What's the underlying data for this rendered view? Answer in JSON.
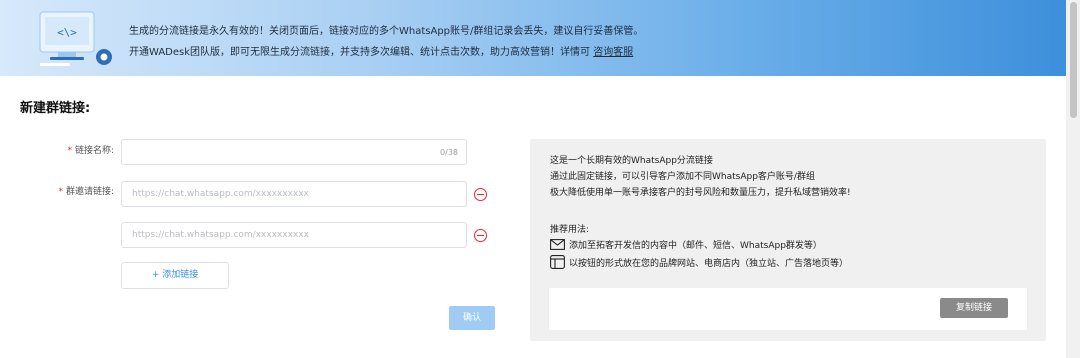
{
  "banner": {
    "line1": "生成的分流链接是永久有效的！关闭页面后，链接对应的多个WhatsApp账号/群组记录会丢失，建议自行妥善保管。",
    "line2_prefix": "开通WADesk团队版，即可无限生成分流链接，并支持多次编辑、统计点击次数，助力高效营销！详情可",
    "line2_link": "咨询客服",
    "illustration_text": "<\\>",
    "icon": "monitor-code-icon"
  },
  "form": {
    "section_title": "新建群链接:",
    "name_label": "链接名称:",
    "name_value": "",
    "name_counter": "0/38",
    "invite_label": "群邀请链接:",
    "invite_links": [
      {
        "value": "",
        "placeholder": "https://chat.whatsapp.com/xxxxxxxxxx"
      },
      {
        "value": "",
        "placeholder": "https://chat.whatsapp.com/xxxxxxxxxx"
      }
    ],
    "add_link_label": "+ 添加链接",
    "confirm_label": "确认"
  },
  "info_panel": {
    "lines": [
      "这是一个长期有效的WhatsApp分流链接",
      "通过此固定链接，可以引导客户添加不同WhatsApp客户账号/群组",
      "极大降低使用单一账号承接客户的封号风险和数量压力，提升私域营销效率!"
    ],
    "usage_title": "推荐用法:",
    "usages": [
      {
        "icon": "mail-icon",
        "text": "添加至拓客开发信的内容中（邮件、短信、WhatsApp群发等）"
      },
      {
        "icon": "layout-icon",
        "text": "以按钮的形式放在您的品牌网站、电商店内（独立站、广告落地页等）"
      }
    ],
    "copy_label": "复制链接"
  },
  "colors": {
    "accent": "#3a8de0",
    "required": "#f5222d",
    "confirm_disabled": "#a0cbf3"
  }
}
